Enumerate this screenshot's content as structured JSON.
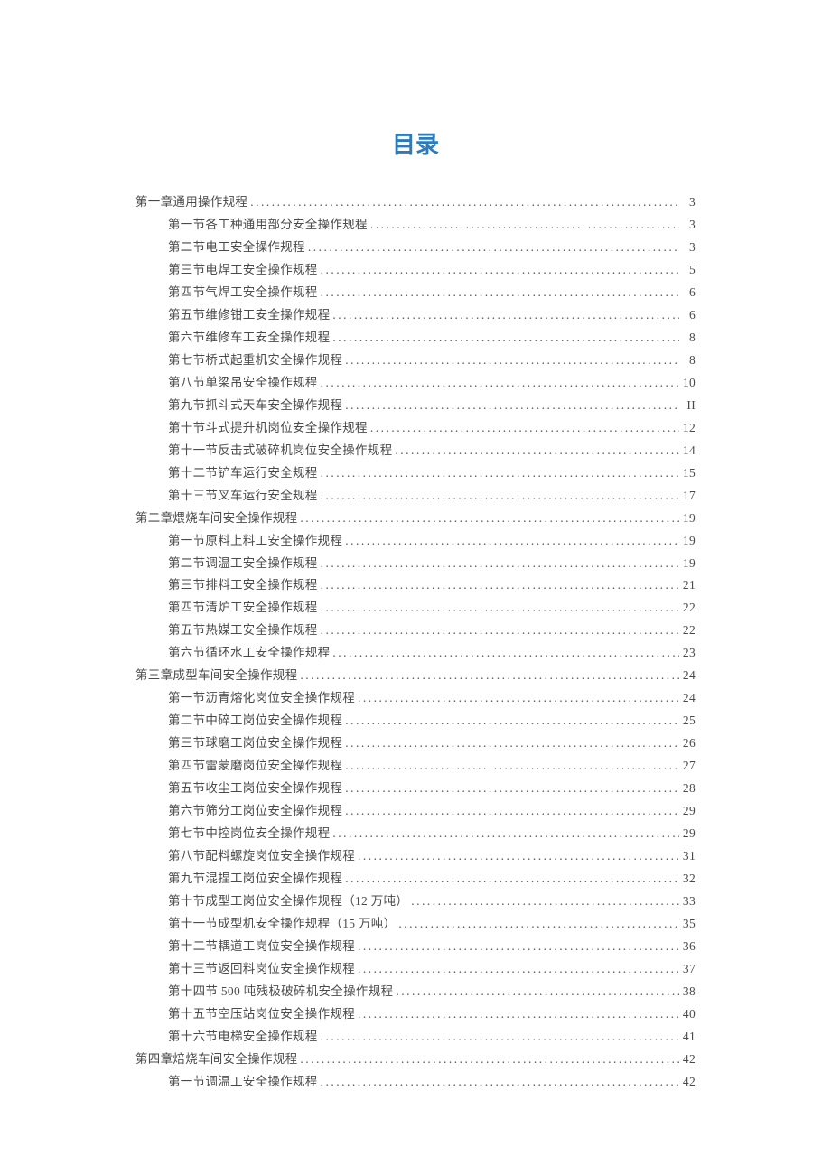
{
  "title": "目录",
  "entries": [
    {
      "level": 1,
      "text": "第一章通用操作规程",
      "page": "3"
    },
    {
      "level": 2,
      "text": "第一节各工种通用部分安全操作规程",
      "page": "3"
    },
    {
      "level": 2,
      "text": "第二节电工安全操作规程",
      "page": "3"
    },
    {
      "level": 2,
      "text": "第三节电焊工安全操作规程",
      "page": "5"
    },
    {
      "level": 2,
      "text": "第四节气焊工安全操作规程",
      "page": "6"
    },
    {
      "level": 2,
      "text": "第五节维修钳工安全操作规程",
      "page": "6"
    },
    {
      "level": 2,
      "text": "第六节维修车工安全操作规程",
      "page": "8"
    },
    {
      "level": 2,
      "text": "第七节桥式起重机安全操作规程",
      "page": "8"
    },
    {
      "level": 2,
      "text": "第八节单梁吊安全操作规程",
      "page": "10"
    },
    {
      "level": 2,
      "text": "第九节抓斗式天车安全操作规程",
      "page": "II"
    },
    {
      "level": 2,
      "text": "第十节斗式提升机岗位安全操作规程",
      "page": "12"
    },
    {
      "level": 2,
      "text": "第十一节反击式破碎机岗位安全操作规程",
      "page": "14"
    },
    {
      "level": 2,
      "text": "第十二节铲车运行安全规程",
      "page": "15"
    },
    {
      "level": 2,
      "text": "第十三节叉车运行安全规程",
      "page": "17"
    },
    {
      "level": 1,
      "text": "第二章煨烧车间安全操作规程",
      "page": "19"
    },
    {
      "level": 2,
      "text": "第一节原料上料工安全操作规程",
      "page": "19"
    },
    {
      "level": 2,
      "text": "第二节调温工安全操作规程",
      "page": "19"
    },
    {
      "level": 2,
      "text": "第三节排料工安全操作规程",
      "page": "21"
    },
    {
      "level": 2,
      "text": "第四节清炉工安全操作规程",
      "page": "22"
    },
    {
      "level": 2,
      "text": "第五节热媒工安全操作规程",
      "page": "22"
    },
    {
      "level": 2,
      "text": "第六节循环水工安全操作规程",
      "page": "23"
    },
    {
      "level": 1,
      "text": "第三章成型车间安全操作规程",
      "page": "24"
    },
    {
      "level": 2,
      "text": "第一节沥青熔化岗位安全操作规程",
      "page": "24"
    },
    {
      "level": 2,
      "text": "第二节中碎工岗位安全操作规程",
      "page": "25"
    },
    {
      "level": 2,
      "text": "第三节球磨工岗位安全操作规程",
      "page": "26"
    },
    {
      "level": 2,
      "text": "第四节雷蒙磨岗位安全操作规程",
      "page": "27"
    },
    {
      "level": 2,
      "text": "第五节收尘工岗位安全操作规程",
      "page": "28"
    },
    {
      "level": 2,
      "text": "第六节筛分工岗位安全操作规程",
      "page": "29"
    },
    {
      "level": 2,
      "text": "第七节中控岗位安全操作规程",
      "page": "29"
    },
    {
      "level": 2,
      "text": "第八节配料螺旋岗位安全操作规程",
      "page": "31"
    },
    {
      "level": 2,
      "text": "第九节混捏工岗位安全操作规程",
      "page": "32"
    },
    {
      "level": 2,
      "text": "第十节成型工岗位安全操作规程（12 万吨）",
      "page": "33"
    },
    {
      "level": 2,
      "text": "第十一节成型机安全操作规程（15 万吨）",
      "page": "35"
    },
    {
      "level": 2,
      "text": "第十二节耦道工岗位安全操作规程",
      "page": "36"
    },
    {
      "level": 2,
      "text": "第十三节返回料岗位安全操作规程",
      "page": "37"
    },
    {
      "level": 2,
      "text": "第十四节 500 吨残极破碎机安全操作规程",
      "page": "38"
    },
    {
      "level": 2,
      "text": "第十五节空压站岗位安全操作规程",
      "page": "40"
    },
    {
      "level": 2,
      "text": "第十六节电梯安全操作规程",
      "page": "41"
    },
    {
      "level": 1,
      "text": "第四章焙烧车间安全操作规程",
      "page": "42"
    },
    {
      "level": 2,
      "text": "第一节调温工安全操作规程",
      "page": "42"
    }
  ]
}
